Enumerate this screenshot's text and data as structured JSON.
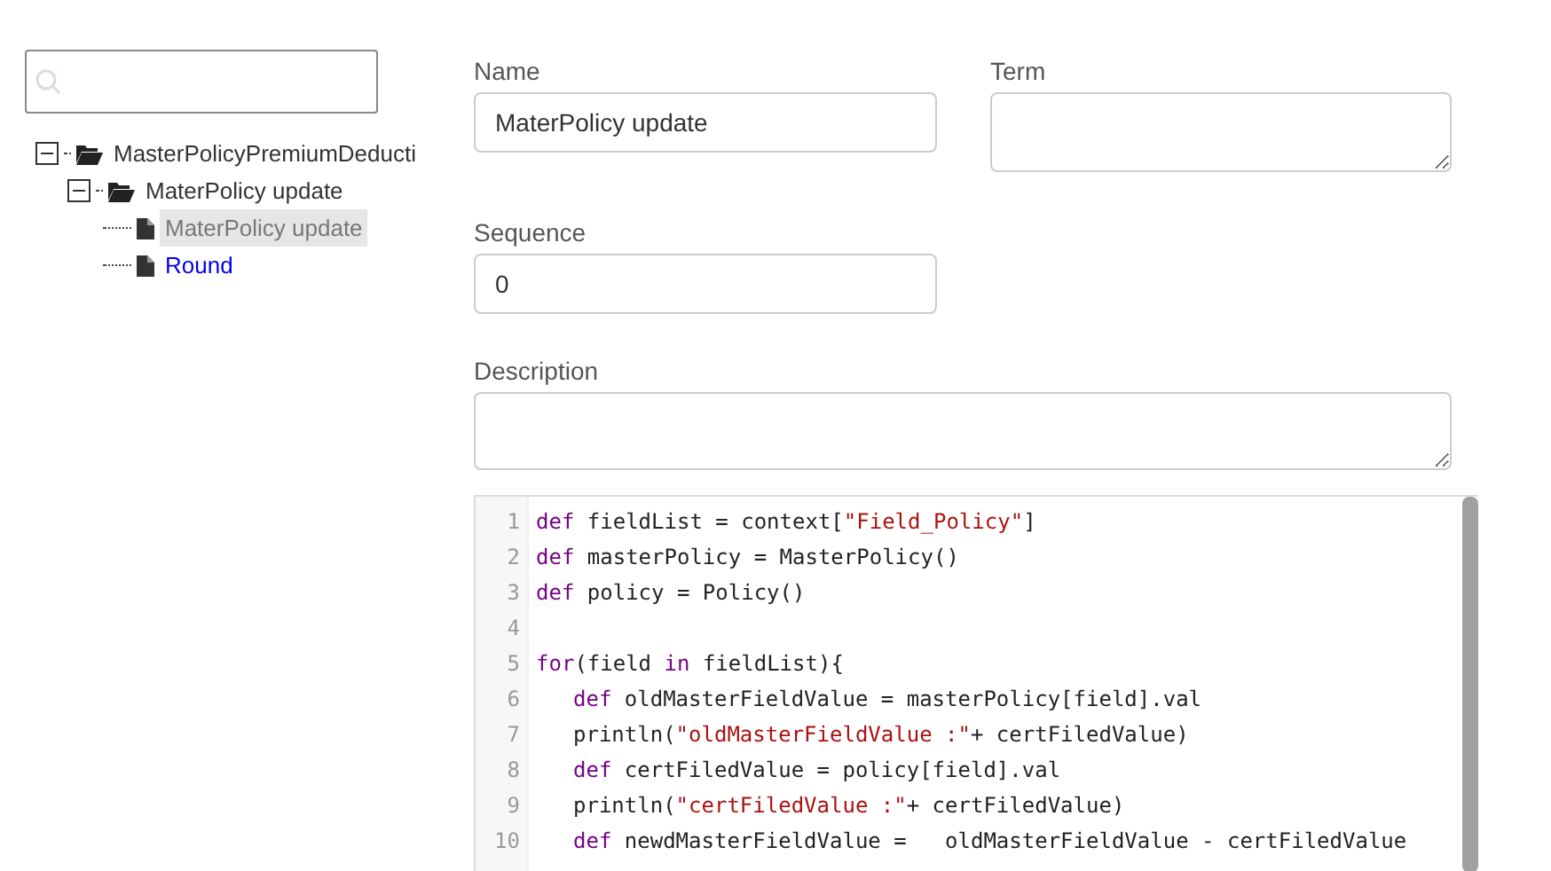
{
  "tree": [
    {
      "label": "MasterPolicyPremiumDeducti",
      "kind": "folder",
      "expanded": true,
      "selected": false,
      "children": [
        {
          "label": "MaterPolicy update",
          "kind": "folder",
          "expanded": true,
          "selected": false,
          "children": [
            {
              "label": "MaterPolicy update",
              "kind": "file",
              "selected": true
            },
            {
              "label": "Round",
              "kind": "file",
              "selected": false
            }
          ]
        }
      ]
    }
  ],
  "form": {
    "name": {
      "label": "Name",
      "value": "MaterPolicy update"
    },
    "term": {
      "label": "Term"
    },
    "sequence": {
      "label": "Sequence",
      "value": "0"
    },
    "description": {
      "label": "Description"
    }
  },
  "code": [
    {
      "number": "1",
      "tokens": [
        {
          "text": "def",
          "kind": "keyword"
        },
        {
          "text": " fieldList = context[",
          "kind": "plain"
        },
        {
          "text": "\"Field_Policy\"",
          "kind": "string"
        },
        {
          "text": "]",
          "kind": "plain"
        }
      ]
    },
    {
      "number": "2",
      "tokens": [
        {
          "text": "def",
          "kind": "keyword"
        },
        {
          "text": " masterPolicy = MasterPolicy()",
          "kind": "plain"
        }
      ]
    },
    {
      "number": "3",
      "tokens": [
        {
          "text": "def",
          "kind": "keyword"
        },
        {
          "text": " policy = Policy()",
          "kind": "plain"
        }
      ]
    },
    {
      "number": "4"
    },
    {
      "number": "5",
      "tokens": [
        {
          "text": "for",
          "kind": "keyword"
        },
        {
          "text": "(field ",
          "kind": "plain"
        },
        {
          "text": "in",
          "kind": "keyword"
        },
        {
          "text": " fieldList){",
          "kind": "plain"
        }
      ]
    },
    {
      "number": "6",
      "indent": true,
      "tokens": [
        {
          "text": "def",
          "kind": "keyword"
        },
        {
          "text": " oldMasterFieldValue = masterPolicy[field].val",
          "kind": "plain"
        }
      ]
    },
    {
      "number": "7",
      "indent": true,
      "tokens": [
        {
          "text": "println(",
          "kind": "plain"
        },
        {
          "text": "\"oldMasterFieldValue :\"",
          "kind": "string"
        },
        {
          "text": "+ certFiledValue)",
          "kind": "plain"
        }
      ]
    },
    {
      "number": "8",
      "indent": true,
      "tokens": [
        {
          "text": "def",
          "kind": "keyword"
        },
        {
          "text": " certFiledValue = policy[field].val",
          "kind": "plain"
        }
      ]
    },
    {
      "number": "9",
      "indent": true,
      "tokens": [
        {
          "text": "println(",
          "kind": "plain"
        },
        {
          "text": "\"certFiledValue :\"",
          "kind": "string"
        },
        {
          "text": "+ certFiledValue)",
          "kind": "plain"
        }
      ]
    },
    {
      "number": "10",
      "indent": true,
      "tokens": [
        {
          "text": "def",
          "kind": "keyword"
        },
        {
          "text": " newdMasterFieldValue =   oldMasterFieldValue - certFiledValue",
          "kind": "plain"
        }
      ]
    }
  ]
}
